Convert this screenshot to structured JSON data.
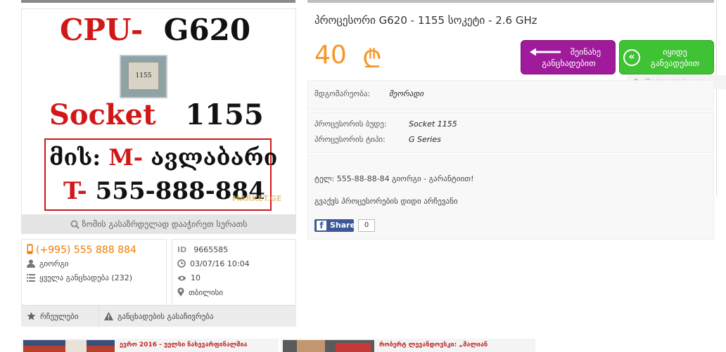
{
  "listing": {
    "title": "პროცესორი G620 - 1155 სოკეტი - 2.6 GHz",
    "price": "40",
    "currency_symbol": "₾",
    "zoom_hint": "ზომის გასაზრდელად დააჭირეთ სურათს"
  },
  "image": {
    "line1_red": "CPU-",
    "line1_black": "G620",
    "chip_label": "1155",
    "line2_red": "Socket",
    "line2_black": "1155",
    "line3_black": "მის:",
    "line3_red": "M-",
    "line3_rest": "ავლაბარი",
    "line4_red": "T-",
    "line4_black": "555-888-884",
    "watermark": "MARKET.GE"
  },
  "buttons": {
    "save_label": "შეინახე განცხადებით",
    "cheap_label": "იყიდე განვადებით",
    "cheap_icon": "«"
  },
  "ghost_tooltip": "Прямоугольник",
  "details": {
    "condition_label": "მდგომარეობა:",
    "condition_value": "მეორადი",
    "socket_label": "პროცესორის ბუდე:",
    "socket_value": "Socket 1155",
    "type_label": "პროცესორის ტიპი:",
    "type_value": "G Series"
  },
  "description": {
    "line1": "ტელ: 555-88-88-84 გიორგი - გარანტიით!",
    "line2": "გვაქვს პროცესორების დიდი არჩევანი"
  },
  "share": {
    "label": "Share",
    "count": "0"
  },
  "seller": {
    "phone": "(+995) 555 888 884",
    "name": "გიორგი",
    "all_ads": "ყველა განცხადება (232)"
  },
  "meta": {
    "id_label": "ID",
    "id_value": "9665585",
    "date": "03/07/16 10:04",
    "views": "10",
    "location": "თბილისი"
  },
  "actions": {
    "favorites": "რჩეულები",
    "report": "განცხადების გასაჩივრება"
  },
  "news": {
    "item1": "ევრო 2016 - უელსი ნახევარფინალშია",
    "item2": "რობერტ ლევანდოვსკი: „მალიან"
  },
  "colors": {
    "price": "#f5962a",
    "phone": "#f07d00",
    "save_button": "#a01a9c",
    "cheap_button": "#3fc233",
    "image_red": "#d01818",
    "facebook": "#3b5998"
  }
}
